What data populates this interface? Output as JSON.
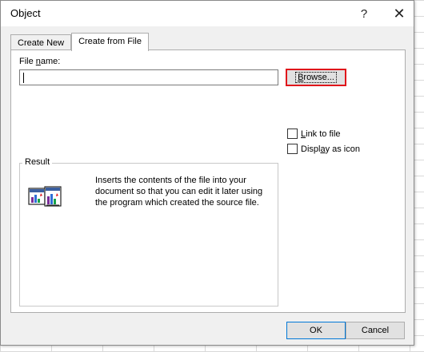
{
  "window": {
    "title": "Object",
    "help_glyph": "?",
    "close_glyph": "✕"
  },
  "tabs": [
    {
      "label": "Create New",
      "active": false
    },
    {
      "label": "Create from File",
      "active": true
    }
  ],
  "file": {
    "label_prefix": "File ",
    "label_accel": "n",
    "label_suffix": "ame:",
    "value": "",
    "browse_accel": "B",
    "browse_rest": "rowse..."
  },
  "options": {
    "link": {
      "accel": "L",
      "rest": "ink to file",
      "checked": false
    },
    "display": {
      "prefix": "Displ",
      "accel": "a",
      "rest": "y as icon",
      "checked": false
    }
  },
  "result": {
    "legend": "Result",
    "text": "Inserts the contents of the file into your document so that you can edit it later using the program which created the source file.",
    "icon": "document-charts-icon"
  },
  "buttons": {
    "ok": "OK",
    "cancel": "Cancel"
  },
  "colors": {
    "highlight_border": "#e0161b",
    "default_button_border": "#0078d7"
  }
}
